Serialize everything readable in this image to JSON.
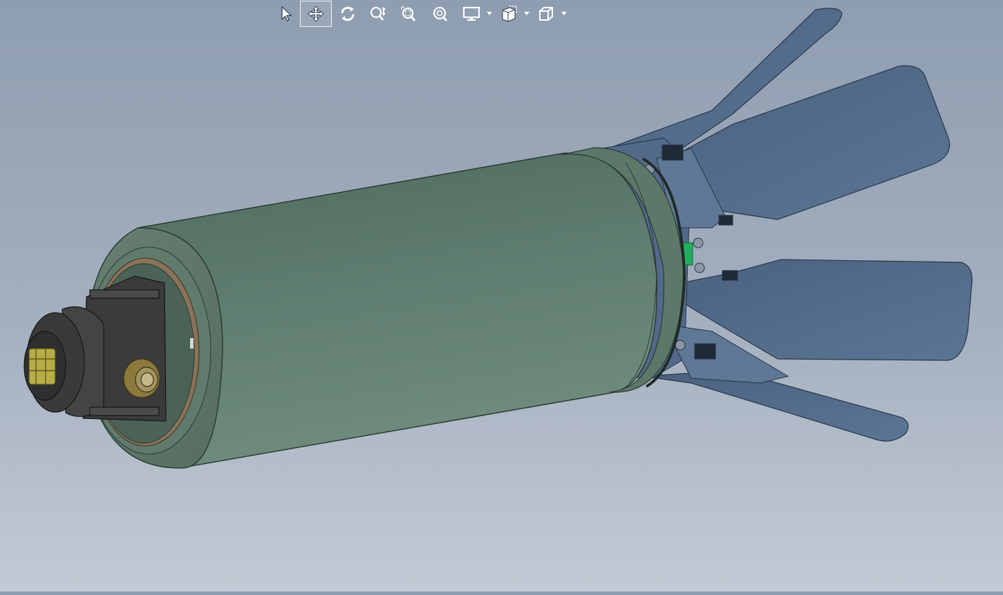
{
  "toolbar": {
    "tools": [
      {
        "name": "select",
        "icon": "arrow-pointer-icon",
        "active": false,
        "dropdown": false
      },
      {
        "name": "pan",
        "icon": "move-cross-icon",
        "active": true,
        "dropdown": false
      },
      {
        "name": "rotate",
        "icon": "rotate-icon",
        "active": false,
        "dropdown": false
      },
      {
        "name": "zoom-in-out",
        "icon": "zoom-in-out-icon",
        "active": false,
        "dropdown": false
      },
      {
        "name": "zoom-to-area",
        "icon": "zoom-area-icon",
        "active": false,
        "dropdown": false
      },
      {
        "name": "zoom-to-fit",
        "icon": "zoom-fit-icon",
        "active": false,
        "dropdown": false
      },
      {
        "name": "display-style",
        "icon": "monitor-icon",
        "active": false,
        "dropdown": true
      },
      {
        "name": "section-view",
        "icon": "section-view-icon",
        "active": false,
        "dropdown": true
      },
      {
        "name": "view-orientation",
        "icon": "cube-icon",
        "active": false,
        "dropdown": true
      }
    ]
  },
  "colors": {
    "background_top": "#8e9db0",
    "background_bottom": "#c3cad4",
    "housing": "#5d7a6c",
    "fan_blades": "#4f6784",
    "connector": "#3d3d3d",
    "terminal": "#bdb24a",
    "accent_green": "#20b060"
  }
}
